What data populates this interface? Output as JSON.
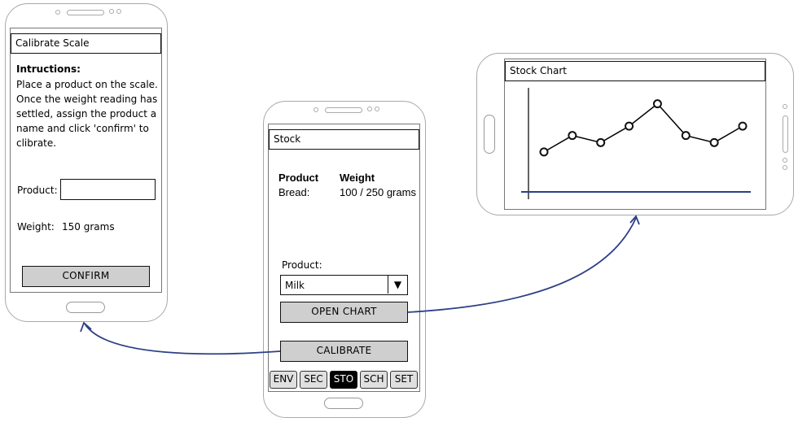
{
  "calibrate_screen": {
    "title": "Calibrate Scale",
    "instructions_heading": "Intructions:",
    "instructions_lines": [
      "Place a product on the scale.",
      "Once the weight reading has",
      "settled, assign the product a",
      "name and click 'confirm' to",
      "clibrate."
    ],
    "product_label": "Product:",
    "product_value": "",
    "weight_label": "Weight:",
    "weight_value": "150 grams",
    "confirm_label": "CONFIRM"
  },
  "stock_screen": {
    "title": "Stock",
    "col_product": "Product",
    "col_weight": "Weight",
    "row_product": "Bread:",
    "row_weight": "100 / 250 grams",
    "product_label": "Product:",
    "product_selected": "Milk",
    "open_chart_label": "OPEN CHART",
    "calibrate_label": "CALIBRATE",
    "tabs": [
      "ENV",
      "SEC",
      "STO",
      "SCH",
      "SET"
    ],
    "active_tab": "STO"
  },
  "chart_screen": {
    "title": "Stock Chart"
  },
  "chart_data": {
    "type": "line",
    "x": [
      1,
      2,
      3,
      4,
      5,
      6,
      7,
      8
    ],
    "values": [
      3.4,
      4.8,
      4.2,
      5.6,
      7.5,
      4.8,
      4.2,
      5.6
    ],
    "ylim": [
      0,
      9
    ],
    "grid": false
  },
  "colors": {
    "arrow": "#2e3f86",
    "chart_line": "#000000",
    "axis_x": "#2e3f86",
    "button_fill": "#cfcfcf"
  }
}
